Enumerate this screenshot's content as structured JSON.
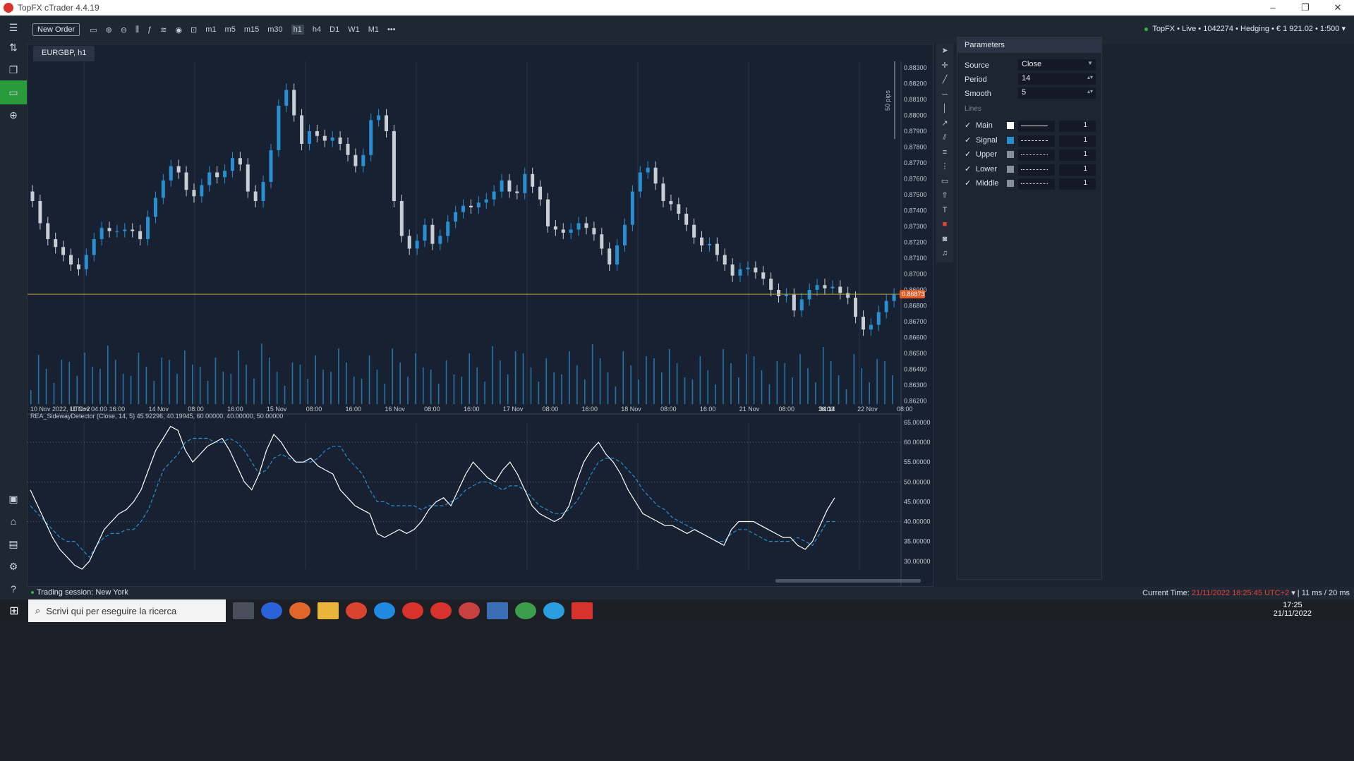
{
  "window": {
    "title": "TopFX cTrader 4.4.19",
    "controls": [
      "–",
      "❐",
      "✕"
    ]
  },
  "toolbar": {
    "new_order": "New Order",
    "timeframes": [
      "m1",
      "m5",
      "m15",
      "m30",
      "h1",
      "h4",
      "D1",
      "W1",
      "M1"
    ],
    "selected_timeframe": "h1",
    "more": "•••",
    "account": "TopFX • Live • 1042274 • Hedging • € 1 921.02 • 1:500"
  },
  "chart_tab": {
    "label": "EURGBP, h1"
  },
  "chart_data": {
    "type": "candlestick",
    "symbol": "EURGBP",
    "timeframe": "h1",
    "price_axis": [
      "0.88300",
      "0.88200",
      "0.88100",
      "0.88000",
      "0.87900",
      "0.87800",
      "0.87700",
      "0.87600",
      "0.87500",
      "0.87400",
      "0.87300",
      "0.87200",
      "0.87100",
      "0.87000",
      "0.86900",
      "0.86800",
      "0.86700",
      "0.86600",
      "0.86500",
      "0.86400",
      "0.86300",
      "0.86200"
    ],
    "ylim": [
      0.8618,
      0.8834
    ],
    "time_axis": [
      "10 Nov 2022, UTC+2",
      "11 Nov 04:00",
      "16:00",
      "14 Nov",
      "08:00",
      "16:00",
      "15 Nov",
      "08:00",
      "16:00",
      "16 Nov",
      "08:00",
      "16:00",
      "17 Nov",
      "08:00",
      "16:00",
      "18 Nov",
      "08:00",
      "16:00",
      "21 Nov",
      "08:00",
      "16:00",
      "22 Nov",
      "08:00"
    ],
    "current_price": "0.86873",
    "current_price_value": 0.86873,
    "countdown": "34:14",
    "pips_label": "50 pips",
    "close_path": [
      0.8746,
      0.8732,
      0.8722,
      0.8717,
      0.8712,
      0.8706,
      0.8703,
      0.8712,
      0.8722,
      0.8729,
      0.8727,
      0.8727,
      0.8728,
      0.8727,
      0.8722,
      0.8736,
      0.8748,
      0.8759,
      0.8768,
      0.8764,
      0.8753,
      0.8749,
      0.8756,
      0.8764,
      0.8761,
      0.8765,
      0.8773,
      0.8769,
      0.8752,
      0.8746,
      0.8758,
      0.8778,
      0.8806,
      0.8816,
      0.88,
      0.8782,
      0.879,
      0.8787,
      0.8784,
      0.8786,
      0.8782,
      0.8775,
      0.8768,
      0.8775,
      0.8797,
      0.88,
      0.879,
      0.8746,
      0.8724,
      0.8716,
      0.8721,
      0.8731,
      0.8719,
      0.8724,
      0.8733,
      0.8739,
      0.8743,
      0.8742,
      0.8745,
      0.8747,
      0.8752,
      0.8759,
      0.8752,
      0.8751,
      0.8763,
      0.8755,
      0.8747,
      0.873,
      0.8728,
      0.8726,
      0.8728,
      0.8732,
      0.8729,
      0.8725,
      0.8716,
      0.8706,
      0.8718,
      0.8731,
      0.8752,
      0.8764,
      0.8767,
      0.8757,
      0.8746,
      0.8744,
      0.8738,
      0.8731,
      0.8723,
      0.8718,
      0.8719,
      0.8712,
      0.8706,
      0.8699,
      0.8703,
      0.8704,
      0.8701,
      0.8697,
      0.869,
      0.8686,
      0.8687,
      0.8677,
      0.8684,
      0.869,
      0.8693,
      0.8691,
      0.8692,
      0.8688,
      0.8685,
      0.8673,
      0.8665,
      0.8668,
      0.8676,
      0.8683,
      0.8687
    ],
    "indicator": {
      "label": "REA_SidewayDetector (Close, 14, 5) 45.92296, 40.19945, 60.00000, 40.00000, 50.00000",
      "axis": [
        "65.00000",
        "60.00000",
        "55.00000",
        "50.00000",
        "45.00000",
        "40.00000",
        "35.00000",
        "30.00000"
      ],
      "ylim": [
        28,
        65
      ],
      "levels": [
        60,
        50,
        40
      ],
      "main": [
        48,
        44,
        40,
        36,
        33,
        31,
        29,
        28,
        30,
        34,
        38,
        40,
        42,
        43,
        45,
        48,
        53,
        58,
        61,
        64,
        63,
        58,
        55,
        57,
        59,
        60,
        61,
        58,
        54,
        50,
        48,
        52,
        58,
        62,
        60,
        57,
        55,
        55,
        56,
        54,
        53,
        52,
        48,
        46,
        44,
        43,
        42,
        37,
        36,
        37,
        38,
        37,
        38,
        40,
        43,
        45,
        46,
        44,
        48,
        52,
        55,
        53,
        51,
        50,
        53,
        55,
        52,
        48,
        44,
        42,
        41,
        40,
        41,
        44,
        50,
        55,
        58,
        60,
        57,
        55,
        52,
        48,
        45,
        42,
        41,
        40,
        39,
        39,
        38,
        37,
        38,
        37,
        36,
        35,
        34,
        38,
        40,
        40,
        40,
        39,
        38,
        37,
        36,
        36,
        34,
        33,
        35,
        39,
        43,
        46
      ],
      "signal": [
        44,
        42,
        40,
        38,
        36,
        35,
        35,
        33,
        31,
        34,
        36,
        37,
        37,
        38,
        38,
        40,
        43,
        48,
        53,
        55,
        57,
        60,
        61,
        61,
        61,
        60,
        60,
        61,
        60,
        58,
        55,
        52,
        53,
        56,
        57,
        56,
        55,
        55,
        55,
        56,
        58,
        59,
        59,
        56,
        54,
        52,
        48,
        45,
        45,
        44,
        44,
        44,
        44,
        43,
        44,
        44,
        44,
        45,
        46,
        48,
        49,
        50,
        50,
        49,
        48,
        49,
        49,
        48,
        46,
        44,
        43,
        42,
        42,
        43,
        45,
        48,
        52,
        55,
        56,
        56,
        55,
        53,
        51,
        48,
        46,
        44,
        43,
        41,
        40,
        39,
        38,
        37,
        36,
        35,
        35,
        37,
        38,
        38,
        37,
        36,
        35,
        35,
        35,
        35,
        36,
        35,
        34,
        37,
        40,
        40
      ]
    }
  },
  "params": {
    "title": "Parameters",
    "fields": [
      {
        "label": "Source",
        "value": "Close"
      },
      {
        "label": "Period",
        "value": "14"
      },
      {
        "label": "Smooth",
        "value": "5"
      }
    ],
    "lines_heading": "Lines",
    "lines": [
      {
        "name": "Main",
        "color": "#ffffff",
        "width": "1"
      },
      {
        "name": "Signal",
        "color": "#2a8fd1",
        "width": "1"
      },
      {
        "name": "Upper",
        "color": "#8a9099",
        "width": "1"
      },
      {
        "name": "Lower",
        "color": "#8a9099",
        "width": "1"
      },
      {
        "name": "Middle",
        "color": "#8a9099",
        "width": "1"
      }
    ]
  },
  "status": {
    "session": "Trading session: New York",
    "current_time_label": "Current Time:",
    "current_time": "21/11/2022 18:25:45",
    "tz": "UTC+2",
    "latency": "11 ms / 20 ms"
  },
  "taskbar": {
    "search_placeholder": "Scrivi qui per eseguire la ricerca",
    "time": "17:25",
    "date": "21/11/2022"
  }
}
